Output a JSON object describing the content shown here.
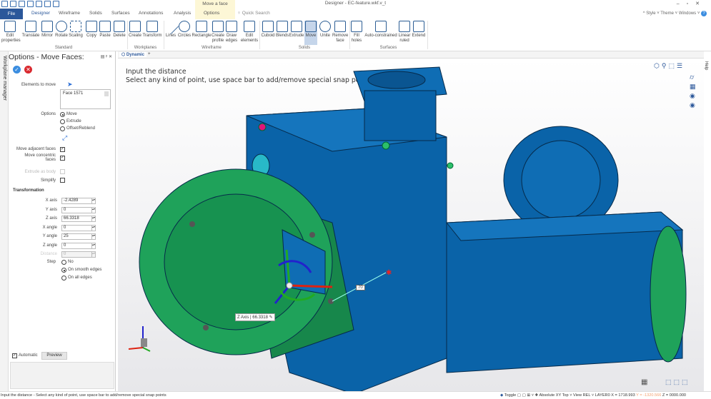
{
  "app": {
    "title": "Designer - EC-feature.wkf.v_t",
    "context_tab": "Move a face",
    "window_buttons": [
      "–",
      "▫",
      "✕"
    ]
  },
  "tabs": {
    "file": "File",
    "items": [
      "Designer",
      "Wireframe",
      "Solids",
      "Surfaces",
      "Annotations",
      "Analysis",
      "Options"
    ],
    "active": "Designer",
    "quick_search": "Quick Search"
  },
  "top_right": {
    "style": "Style",
    "theme": "Theme",
    "windows": "Windows",
    "help": "?"
  },
  "ribbon": {
    "buttons": [
      {
        "label": "Edit properties",
        "icon": "edit-properties-icon"
      },
      {
        "label": "Translate",
        "icon": "translate-icon"
      },
      {
        "label": "Mirror",
        "icon": "mirror-icon"
      },
      {
        "label": "Rotate",
        "icon": "rotate-icon"
      },
      {
        "label": "Scaling",
        "icon": "scaling-icon"
      },
      {
        "label": "Copy",
        "icon": "copy-icon"
      },
      {
        "label": "Paste",
        "icon": "paste-icon"
      },
      {
        "label": "Delete",
        "icon": "delete-icon"
      },
      {
        "label": "Create",
        "icon": "create-workplane-icon"
      },
      {
        "label": "Transform",
        "icon": "transform-workplane-icon"
      },
      {
        "label": "Lines",
        "icon": "lines-icon"
      },
      {
        "label": "Circles",
        "icon": "circles-icon"
      },
      {
        "label": "Rectangle",
        "icon": "rectangle-icon"
      },
      {
        "label": "Create profile",
        "icon": "create-profile-icon"
      },
      {
        "label": "Draw edges",
        "icon": "draw-edges-icon"
      },
      {
        "label": "Edit elements",
        "icon": "edit-elements-icon"
      },
      {
        "label": "Cuboid",
        "icon": "cuboid-icon"
      },
      {
        "label": "Blends",
        "icon": "blends-icon"
      },
      {
        "label": "Extrude",
        "icon": "extrude-icon"
      },
      {
        "label": "Move",
        "icon": "move-icon"
      },
      {
        "label": "Unite",
        "icon": "unite-icon"
      },
      {
        "label": "Remove face",
        "icon": "remove-face-icon"
      },
      {
        "label": "Fill holes",
        "icon": "fill-holes-icon"
      },
      {
        "label": "Auto-constrained",
        "icon": "auto-constrained-icon"
      },
      {
        "label": "Linear ruled",
        "icon": "linear-ruled-icon"
      },
      {
        "label": "Extend",
        "icon": "extend-icon"
      }
    ],
    "groups": [
      "Standard",
      "Workplanes",
      "Wireframe",
      "Solids",
      "Surfaces"
    ]
  },
  "side_tab": "Workplane manager",
  "panel": {
    "title": "Options - Move Faces:",
    "elements_label": "Elements to move",
    "elements": [
      "Face 1571"
    ],
    "options_label": "Options",
    "options": [
      "Move",
      "Extrude",
      "Offset/Reblend"
    ],
    "option_selected": "Move",
    "move_adjacent_label": "Move adjacent faces",
    "move_adjacent": true,
    "move_concentric_label": "Move concentric faces",
    "move_concentric": true,
    "extrude_body_label": "Extrude as body",
    "extrude_body": false,
    "simplify_label": "Simplify",
    "simplify": false,
    "transformation_label": "Transformation",
    "fields": [
      {
        "label": "X axis",
        "value": "-2.4289"
      },
      {
        "label": "Y axis",
        "value": "0"
      },
      {
        "label": "Z axis",
        "value": "66.3318"
      },
      {
        "label": "X angle",
        "value": "0"
      },
      {
        "label": "Y angle",
        "value": "25"
      },
      {
        "label": "Z angle",
        "value": "0"
      },
      {
        "label": "Distance",
        "value": "0"
      }
    ],
    "step_label": "Step",
    "steps": [
      "No",
      "On smooth edges",
      "On all edges"
    ],
    "step_selected": "On smooth edges",
    "automatic_label": "Automatic",
    "automatic": true,
    "preview_label": "Preview"
  },
  "viewport": {
    "tab": "Dynamic",
    "prompt_line1": "Input the distance",
    "prompt_line2": "Select any kind of point, use space bar to add/remove special snap points",
    "dim_label": "70",
    "zaxis_label": "Z Axis",
    "zaxis_value": "66.3318",
    "colors": {
      "body": "#0a63a8",
      "moved_face": "#1fa25a",
      "background": "#ececee"
    }
  },
  "help_tab": "Help",
  "status": {
    "message": "Input the distance - Select any kind of point, use space bar to add/remove special snap points",
    "toggle": "Toggle",
    "plane": "Absolute XY Top",
    "view": "View REL",
    "layer": "LAYER0",
    "x": "X = 1718.993",
    "y": "Y = -1320.566",
    "z": "Z = 0000.000"
  }
}
